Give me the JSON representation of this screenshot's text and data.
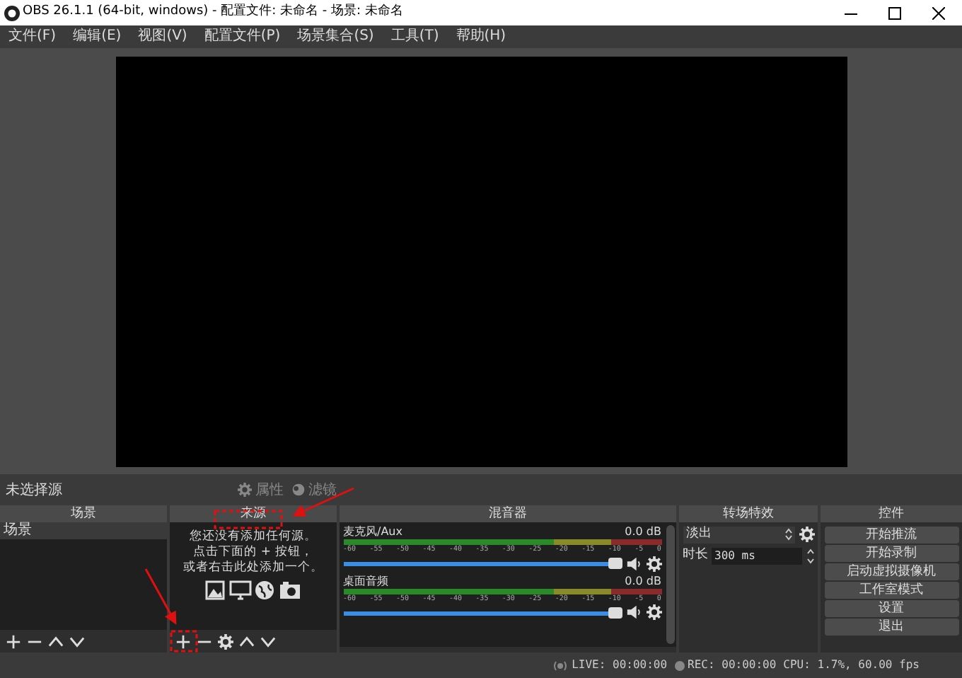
{
  "window": {
    "title": "OBS 26.1.1 (64-bit, windows) - 配置文件: 未命名 - 场景: 未命名"
  },
  "menu": [
    "文件(F)",
    "编辑(E)",
    "视图(V)",
    "配置文件(P)",
    "场景集合(S)",
    "工具(T)",
    "帮助(H)"
  ],
  "source_bar": {
    "label": "未选择源",
    "buttons": [
      {
        "kind": "properties",
        "label": "属性",
        "disabled": true
      },
      {
        "kind": "filters",
        "label": "滤镜",
        "disabled": true
      }
    ]
  },
  "scenes": {
    "title": "场景",
    "items": [
      {
        "label": "场景",
        "selected": true
      }
    ]
  },
  "sources": {
    "title": "来源",
    "empty_lines": [
      "您还没有添加任何源。",
      "点击下面的 + 按钮，",
      "或者右击此处添加一个。"
    ]
  },
  "mixer": {
    "title": "混音器",
    "channels": [
      {
        "name": "麦克风/Aux",
        "reading": "0.0 dB",
        "level": 1,
        "ticks": [
          "-60",
          "-55",
          "-50",
          "-45",
          "-40",
          "-35",
          "-30",
          "-25",
          "-20",
          "-15",
          "-10",
          "-5",
          "0"
        ]
      },
      {
        "name": "桌面音频",
        "reading": "0.0 dB",
        "level": 1,
        "ticks": [
          "-60",
          "-55",
          "-50",
          "-45",
          "-40",
          "-35",
          "-30",
          "-25",
          "-20",
          "-15",
          "-10",
          "-5",
          "0"
        ]
      }
    ]
  },
  "transitions": {
    "title": "转场特效",
    "selected": "淡出",
    "duration_label": "时长",
    "duration": "300 ms"
  },
  "controls": {
    "title": "控件",
    "buttons": [
      "开始推流",
      "开始录制",
      "启动虚拟摄像机",
      "工作室模式",
      "设置",
      "退出"
    ]
  },
  "status_bar": {
    "live": "LIVE: 00:00:00",
    "rec": "REC: 00:00:00",
    "cpu": "CPU: 1.7%, 60.00 fps"
  }
}
